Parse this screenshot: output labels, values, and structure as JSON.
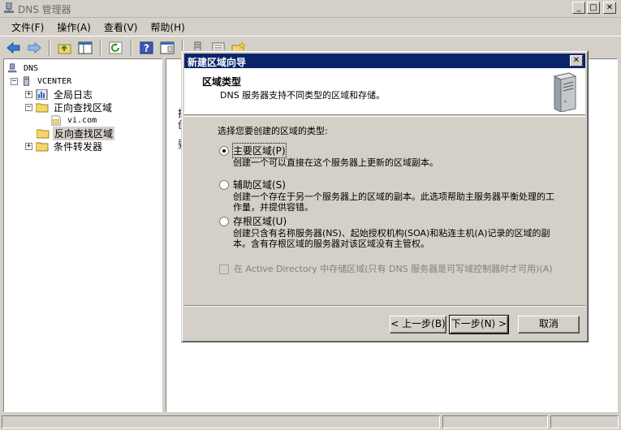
{
  "window": {
    "title": "DNS 管理器",
    "controls": [
      "_",
      "□",
      "✕"
    ]
  },
  "menu": [
    "文件(F)",
    "操作(A)",
    "查看(V)",
    "帮助(H)"
  ],
  "tree": {
    "root": "DNS",
    "server": "VCENTER",
    "global_log": "全局日志",
    "forward_zones": "正向查找区域",
    "zone_vi": "vi.com",
    "reverse_zones": "反向查找区域",
    "conditional_forwarders": "条件转发器",
    "expanded": "−",
    "collapsed": "+"
  },
  "detail_partial": [
    "找",
    "创",
    "要"
  ],
  "dialog": {
    "title": "新建区域向导",
    "close": "✕",
    "header_title": "区域类型",
    "header_subtitle": "DNS 服务器支持不同类型的区域和存储。",
    "prompt": "选择您要创建的区域的类型:",
    "options": [
      {
        "label": "主要区域(P)",
        "desc": "创建一个可以直接在这个服务器上更新的区域副本。",
        "selected": true
      },
      {
        "label": "辅助区域(S)",
        "desc": "创建一个存在于另一个服务器上的区域的副本。此选项帮助主服务器平衡处理的工作量，并提供容错。",
        "selected": false
      },
      {
        "label": "存根区域(U)",
        "desc": "创建只含有名称服务器(NS)、起始授权机构(SOA)和粘连主机(A)记录的区域的副本。含有存根区域的服务器对该区域没有主管权。",
        "selected": false
      }
    ],
    "ad_store_label": "在 Active Directory 中存储区域(只有 DNS 服务器是可写域控制器时才可用)(A)",
    "ad_store_checked": false,
    "buttons": {
      "back": "< 上一步(B)",
      "next": "下一步(N) >",
      "cancel": "取消"
    }
  }
}
